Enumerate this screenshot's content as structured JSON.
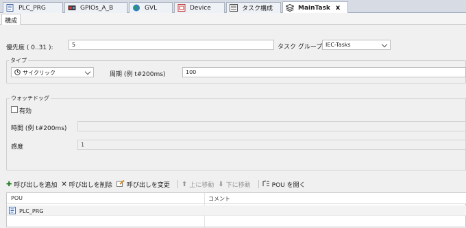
{
  "tabs": [
    {
      "label": "PLC_PRG",
      "icon": "program-icon"
    },
    {
      "label": "GPIOs_A_B",
      "icon": "device-io-icon"
    },
    {
      "label": "GVL",
      "icon": "globe-icon"
    },
    {
      "label": "Device",
      "icon": "device-icon"
    },
    {
      "label": "タスク構成",
      "icon": "task-config-icon"
    },
    {
      "label": "MainTask",
      "icon": "task-icon",
      "close": "x"
    }
  ],
  "subtab": {
    "label": "構成"
  },
  "priority": {
    "label": "優先度 ( 0..31 ):",
    "value": "5"
  },
  "task_group": {
    "label": "タスク グループ",
    "value": "IEC-Tasks"
  },
  "type_group": {
    "title": "タイプ",
    "type_value": "サイクリック",
    "interval_label": "周期 (例 t#200ms)",
    "interval_value": "100"
  },
  "watchdog": {
    "title": "ウォッチドッグ",
    "enable_label": "有効",
    "time_label": "時間 (例 t#200ms)",
    "time_value": "",
    "sensitivity_label": "感度",
    "sensitivity_value": "1"
  },
  "toolbar": {
    "add_call": "呼び出しを追加",
    "remove_call": "呼び出しを削除",
    "change_call": "呼び出しを変更",
    "move_up": "上に移動",
    "move_down": "下に移動",
    "open_pou": "POU を開く"
  },
  "grid": {
    "columns": [
      "POU",
      "コメント"
    ],
    "rows": [
      {
        "pou": "PLC_PRG",
        "comment": ""
      }
    ]
  }
}
